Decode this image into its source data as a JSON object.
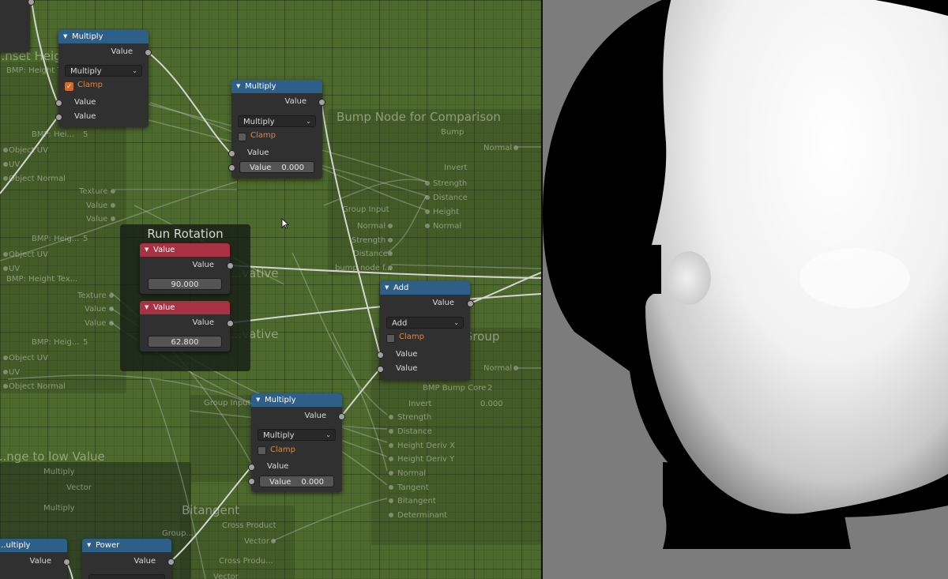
{
  "ghost_text": {
    "height_texture": "...nset Height Texture",
    "bump_compare": "Bump Node for Comparison",
    "bump_group": "Bump Group",
    "bitangent": "Bitangent",
    "change_low": "...nge to low Value",
    "derivative1": "...vative",
    "derivative2": "...vative",
    "bmp_height_tex": "BMP: Height Tex...",
    "bmp_hei1": "BMP: Hei...",
    "bmp_hei2": "BMP: Heig...",
    "bmp_hei3": "BMP: Heig...",
    "bmp_hei4": "BMP: Heig...",
    "five": "5",
    "object_uv": "Object UV",
    "uv": "UV",
    "object_normal": "Object Normal",
    "texture": "Texture",
    "value": "Value",
    "group_input": "Group Input",
    "group_input2": "Group Input",
    "normal": "Normal",
    "strength": "Strength",
    "distance": "Distance",
    "height": "Height",
    "invert": "Invert",
    "bump": "Bump",
    "bump_node_f": "bump node f...",
    "bmp_bump_core": "BMP  Bump Core",
    "two": "2",
    "zero": "0.000",
    "height_deriv_x": "Height Deriv X",
    "height_deriv_y": "Height Deriv Y",
    "tangent": "Tangent",
    "bitangent_s": "Bitangent",
    "determinant": "Determinant",
    "cross_product": "Cross Product",
    "vector": "Vector",
    "cross_prod": "Cross Produ...",
    "multiply": "Multiply",
    "group": "Group..."
  },
  "frame_run_rotation": {
    "label": "Run Rotation"
  },
  "nodes": {
    "mult1": {
      "title": "Multiply",
      "out": "Value",
      "op": "Multiply",
      "clamp": "Clamp",
      "in1": "Value",
      "in2": "Value"
    },
    "mult2": {
      "title": "Multiply",
      "out": "Value",
      "op": "Multiply",
      "clamp": "Clamp",
      "in1": "Value",
      "in2_label": "Value",
      "in2_val": "0.000"
    },
    "value1": {
      "title": "Value",
      "out": "Value",
      "val": "90.000"
    },
    "value2": {
      "title": "Value",
      "out": "Value",
      "val": "62.800"
    },
    "add": {
      "title": "Add",
      "out": "Value",
      "op": "Add",
      "clamp": "Clamp",
      "in1": "Value",
      "in2": "Value"
    },
    "mult3": {
      "title": "Multiply",
      "out": "Value",
      "op": "Multiply",
      "clamp": "Clamp",
      "in1": "Value",
      "in2_label": "Value",
      "in2_val": "0.000"
    },
    "mult4": {
      "title": "...ultiply",
      "out": "Value"
    },
    "power": {
      "title": "Power",
      "out": "Value"
    }
  },
  "colors": {
    "editor_bg": "#4d6a2c",
    "header_blue": "#2d5f88",
    "header_red": "#a83243",
    "clamp_orange": "#e0873c",
    "viewport_bg": "#7c7c7c"
  }
}
